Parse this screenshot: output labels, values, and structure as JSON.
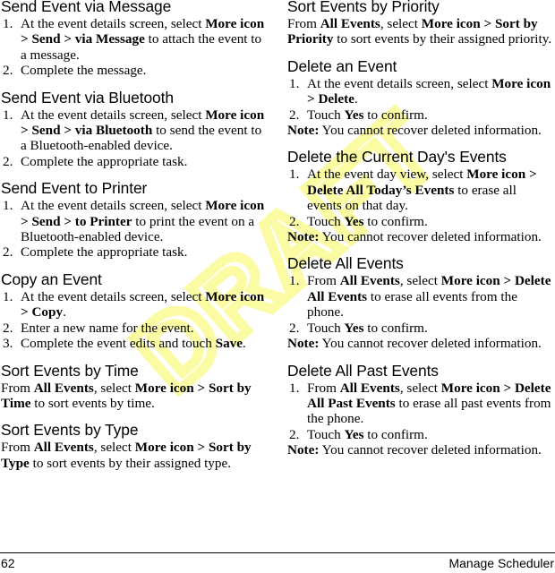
{
  "document": {
    "page_number": "62",
    "chapter_title": "Manage Scheduler",
    "watermark": "DRAFT",
    "watermark_color": "#fbfba4"
  },
  "left_column": [
    {
      "type": "section",
      "heading": "Send Event via Message",
      "steps": [
        [
          {
            "t": "At the event details screen, select ",
            "b": false
          },
          {
            "t": "More icon > Send > via Message",
            "b": true
          },
          {
            "t": " to attach the event to a message.",
            "b": false
          }
        ],
        [
          {
            "t": "Complete the message.",
            "b": false
          }
        ]
      ]
    },
    {
      "type": "section",
      "heading": "Send Event via Bluetooth",
      "steps": [
        [
          {
            "t": "At the event details screen, select ",
            "b": false
          },
          {
            "t": "More icon > Send > via Bluetooth",
            "b": true
          },
          {
            "t": " to send the event to a Bluetooth-enabled device.",
            "b": false
          }
        ],
        [
          {
            "t": "Complete the appropriate task.",
            "b": false
          }
        ]
      ]
    },
    {
      "type": "section",
      "heading": "Send Event to Printer",
      "steps": [
        [
          {
            "t": "At the event details screen, select ",
            "b": false
          },
          {
            "t": "More icon > Send > to Printer",
            "b": true
          },
          {
            "t": " to print the event on a Bluetooth-enabled device.",
            "b": false
          }
        ],
        [
          {
            "t": "Complete the appropriate task.",
            "b": false
          }
        ]
      ]
    },
    {
      "type": "section",
      "heading": "Copy an Event",
      "steps": [
        [
          {
            "t": "At the event details screen, select ",
            "b": false
          },
          {
            "t": "More icon > Copy",
            "b": true
          },
          {
            "t": ".",
            "b": false
          }
        ],
        [
          {
            "t": "Enter a new name for the event.",
            "b": false
          }
        ],
        [
          {
            "t": "Complete the event edits and touch ",
            "b": false
          },
          {
            "t": "Save",
            "b": true
          },
          {
            "t": ".",
            "b": false
          }
        ]
      ]
    },
    {
      "type": "section",
      "heading": "Sort Events by Time",
      "paragraph": [
        {
          "t": "From ",
          "b": false
        },
        {
          "t": "All Events",
          "b": true
        },
        {
          "t": ", select ",
          "b": false
        },
        {
          "t": "More icon > Sort by Time",
          "b": true
        },
        {
          "t": " to sort events by time.",
          "b": false
        }
      ]
    },
    {
      "type": "section",
      "heading": "Sort Events by Type",
      "paragraph": [
        {
          "t": "From ",
          "b": false
        },
        {
          "t": "All Events",
          "b": true
        },
        {
          "t": ", select ",
          "b": false
        },
        {
          "t": "More icon > Sort by Type",
          "b": true
        },
        {
          "t": " to sort events by their assigned type.",
          "b": false
        }
      ]
    }
  ],
  "right_column": [
    {
      "type": "section",
      "heading": "Sort Events by Priority",
      "paragraph": [
        {
          "t": "From ",
          "b": false
        },
        {
          "t": "All Events",
          "b": true
        },
        {
          "t": ", select ",
          "b": false
        },
        {
          "t": "More icon > Sort by Priority",
          "b": true
        },
        {
          "t": " to sort events by their assigned priority.",
          "b": false
        }
      ]
    },
    {
      "type": "section",
      "heading": "Delete an Event",
      "steps": [
        [
          {
            "t": "At the event details screen, select ",
            "b": false
          },
          {
            "t": "More icon > Delete",
            "b": true
          },
          {
            "t": ".",
            "b": false
          }
        ],
        [
          {
            "t": "Touch ",
            "b": false
          },
          {
            "t": "Yes",
            "b": true
          },
          {
            "t": " to confirm.",
            "b": false
          }
        ]
      ],
      "note_label": "Note:",
      "note_text": " You cannot recover deleted information."
    },
    {
      "type": "section",
      "heading": "Delete the Current Day's Events",
      "steps": [
        [
          {
            "t": "At the event day view, select ",
            "b": false
          },
          {
            "t": "More icon > Delete All Today’s Events",
            "b": true
          },
          {
            "t": " to erase all events on that day.",
            "b": false
          }
        ],
        [
          {
            "t": "Touch ",
            "b": false
          },
          {
            "t": "Yes",
            "b": true
          },
          {
            "t": " to confirm.",
            "b": false
          }
        ]
      ],
      "note_label": "Note:",
      "note_text": " You cannot recover deleted information."
    },
    {
      "type": "section",
      "heading": "Delete All Events",
      "steps": [
        [
          {
            "t": "From ",
            "b": false
          },
          {
            "t": "All Events",
            "b": true
          },
          {
            "t": ", select ",
            "b": false
          },
          {
            "t": "More icon > Delete All Events",
            "b": true
          },
          {
            "t": " to erase all events from the phone.",
            "b": false
          }
        ],
        [
          {
            "t": "Touch ",
            "b": false
          },
          {
            "t": "Yes",
            "b": true
          },
          {
            "t": " to confirm.",
            "b": false
          }
        ]
      ],
      "note_label": "Note:",
      "note_text": " You cannot recover deleted information."
    },
    {
      "type": "section",
      "heading": "Delete All Past Events",
      "steps": [
        [
          {
            "t": "From ",
            "b": false
          },
          {
            "t": "All Events",
            "b": true
          },
          {
            "t": ", select ",
            "b": false
          },
          {
            "t": "More icon > Delete All Past Events",
            "b": true
          },
          {
            "t": " to erase all past events from the phone.",
            "b": false
          }
        ],
        [
          {
            "t": "Touch ",
            "b": false
          },
          {
            "t": "Yes",
            "b": true
          },
          {
            "t": " to confirm.",
            "b": false
          }
        ]
      ],
      "note_label": "Note:",
      "note_text": " You cannot recover deleted information."
    }
  ]
}
